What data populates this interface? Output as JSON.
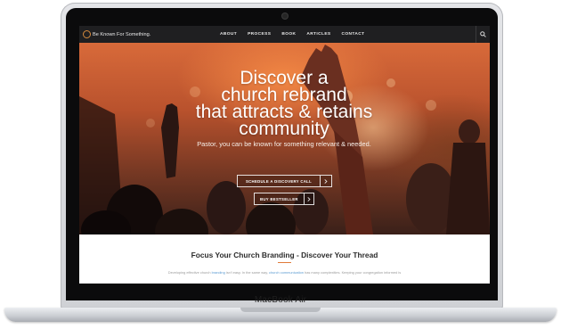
{
  "device": {
    "brand_label": "MacBook Air"
  },
  "site": {
    "logo_text": "Be Known For Something.",
    "nav": [
      {
        "label": "ABOUT"
      },
      {
        "label": "PROCESS"
      },
      {
        "label": "BOOK"
      },
      {
        "label": "ARTICLES"
      },
      {
        "label": "CONTACT"
      }
    ],
    "search_icon": "search-icon"
  },
  "hero": {
    "title_lines": [
      "Discover a",
      "church rebrand",
      "that attracts & retains",
      "community"
    ],
    "subtitle": "Pastor, you can be known for something relevant & needed.",
    "primary_cta": "SCHEDULE A DISCOVERY CALL",
    "secondary_cta": "BUY BESTSELLER",
    "cta_icon": "chevron-right-icon"
  },
  "section": {
    "title": "Focus Your Church Branding - Discover Your Thread",
    "accent_color": "#e07b39",
    "body_parts": [
      "Developing effective church ",
      "branding",
      " isn't easy. In the same way, ",
      "church communication",
      " has many complexities. Keeping your congregation informed is"
    ]
  },
  "colors": {
    "nav_bg": "#1f1f21",
    "hero_orange": "#d86a3a",
    "link": "#5b9bd1"
  }
}
